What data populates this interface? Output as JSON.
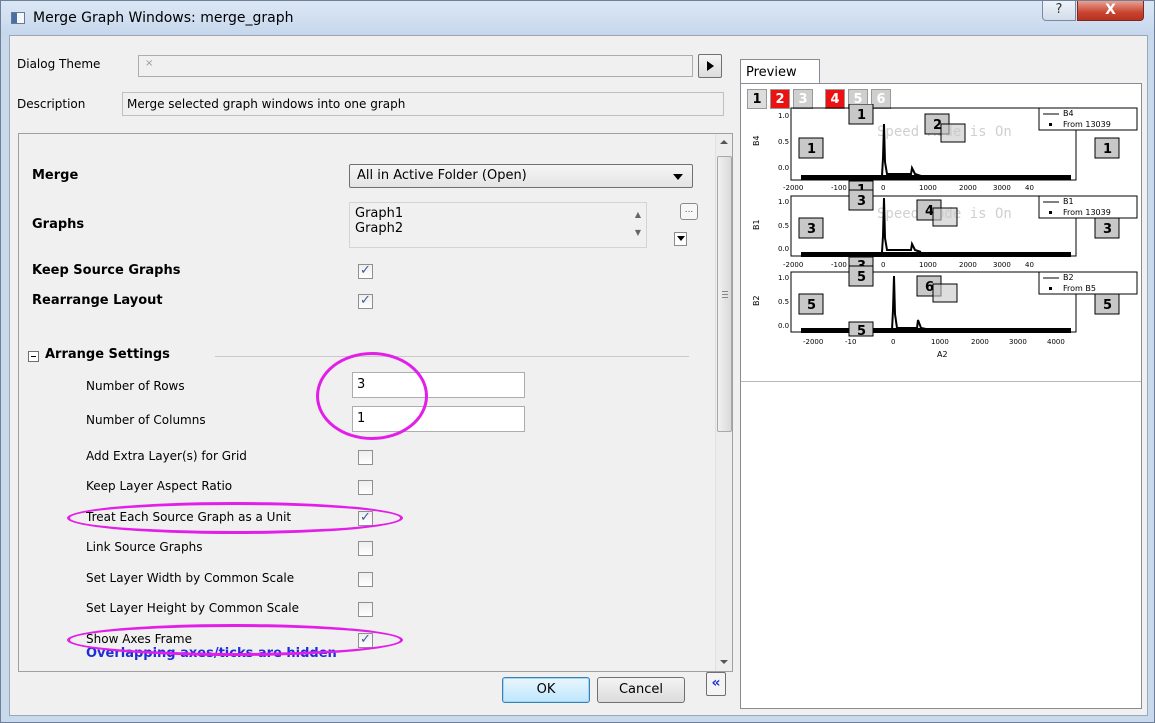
{
  "window": {
    "title": "Merge Graph Windows: merge_graph",
    "help_label": "?",
    "close_label": "X"
  },
  "top": {
    "theme_label": "Dialog Theme",
    "theme_value": "×",
    "description_label": "Description",
    "description_value": "Merge selected graph windows into one graph"
  },
  "settings": {
    "merge_label": "Merge",
    "merge_value": "All in Active Folder (Open)",
    "graphs_label": "Graphs",
    "graphs_list": [
      "Graph1",
      "Graph2"
    ],
    "graphs_browse_label": "...",
    "keep_source_label": "Keep Source Graphs",
    "keep_source_checked": true,
    "rearrange_label": "Rearrange Layout",
    "rearrange_checked": true,
    "arrange_group_label": "Arrange Settings",
    "rows_label": "Number of Rows",
    "rows_value": "3",
    "cols_label": "Number of Columns",
    "cols_value": "1",
    "extra_layers_label": "Add Extra Layer(s) for Grid",
    "extra_layers_checked": false,
    "aspect_label": "Keep Layer Aspect Ratio",
    "aspect_checked": false,
    "unit_label": "Treat Each Source Graph as a Unit",
    "unit_checked": true,
    "link_label": "Link Source Graphs",
    "link_checked": false,
    "width_label": "Set Layer Width by Common Scale",
    "width_checked": false,
    "height_label": "Set Layer Height by Common Scale",
    "height_checked": false,
    "frame_label": "Show Axes Frame",
    "frame_checked": true,
    "warning": "Overlapping axes/ticks are hidden"
  },
  "buttons": {
    "ok": "OK",
    "cancel": "Cancel",
    "collapse": "«"
  },
  "preview": {
    "tab_label": "Preview",
    "layer_tabs": [
      {
        "label": "1",
        "style": "plain"
      },
      {
        "label": "2",
        "style": "red"
      },
      {
        "label": "3",
        "style": "gray"
      },
      {
        "label": "4",
        "style": "red"
      },
      {
        "label": "5",
        "style": "gray"
      },
      {
        "label": "6",
        "style": "gray"
      }
    ],
    "panels": [
      {
        "ylabel": "B4",
        "legend_series": "B4",
        "legend_source": "From 13039",
        "yticks": [
          "1.0",
          "0.5",
          "0.0"
        ],
        "xticks": [
          "-2000",
          "-100",
          "0",
          "1000",
          "2000",
          "3000",
          "40"
        ],
        "left_box": "1",
        "right_box": "1",
        "top_box": "1",
        "bottom_box": "1",
        "mid_box": "2"
      },
      {
        "ylabel": "B1",
        "legend_series": "B1",
        "legend_source": "From 13039",
        "yticks": [
          "1.0",
          "0.5",
          "0.0"
        ],
        "xticks": [
          "-2000",
          "-100",
          "0",
          "1000",
          "2000",
          "3000",
          "40"
        ],
        "left_box": "3",
        "right_box": "3",
        "top_box": "3",
        "bottom_box": "3",
        "mid_box": "4"
      },
      {
        "ylabel": "B2",
        "legend_series": "B2",
        "legend_source": "From B5",
        "yticks": [
          "1.0",
          "0.5",
          "0.0"
        ],
        "xticks": [
          "-2000",
          "-10",
          "0",
          "1000",
          "2000",
          "3000",
          "4000"
        ],
        "left_box": "5",
        "right_box": "5",
        "top_box": "5",
        "bottom_box": "5",
        "mid_box": "6"
      }
    ],
    "xlabel": "A2",
    "watermark": "Speed Mode is On"
  },
  "colors": {
    "highlight": "#e21ee8",
    "warning_text": "#1a2fd6",
    "tab_red": "#ee1111"
  }
}
